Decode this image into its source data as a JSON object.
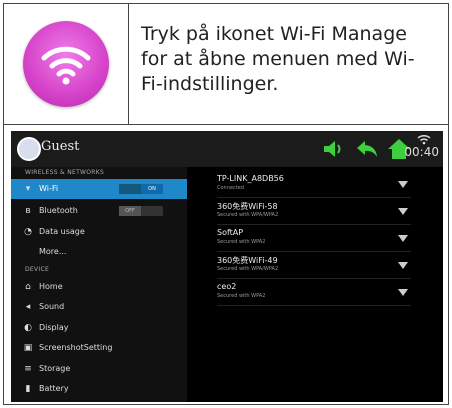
{
  "instruction": "Tryk på ikonet Wi-Fi Manage for at åbne menuen med Wi-Fi-indstillinger.",
  "status": {
    "user": "Guest",
    "time": "00:40"
  },
  "settings": {
    "section_wireless": "WIRELESS & NETWORKS",
    "section_device": "DEVICE",
    "wifi": {
      "label": "Wi-Fi",
      "toggle": "ON"
    },
    "bluetooth": {
      "label": "Bluetooth",
      "toggle": "OFF"
    },
    "data_usage": "Data usage",
    "more": "More...",
    "home": "Home",
    "sound": "Sound",
    "display": "Display",
    "screenshot": "ScreenshotSetting",
    "storage": "Storage",
    "battery": "Battery"
  },
  "networks": [
    {
      "name": "TP-LINK_A8DB56",
      "status": "Connected"
    },
    {
      "name": "360免费WiFi-58",
      "status": "Secured with WPA/WPA2"
    },
    {
      "name": "SoftAP",
      "status": "Secured with WPA2"
    },
    {
      "name": "360免费WiFi-49",
      "status": "Secured with WPA/WPA2"
    },
    {
      "name": "ceo2",
      "status": "Secured with WPA2"
    }
  ],
  "colors": {
    "accent": "#1e88c8",
    "status_green": "#3ecf3e",
    "icon_pink": "#d542c9"
  }
}
